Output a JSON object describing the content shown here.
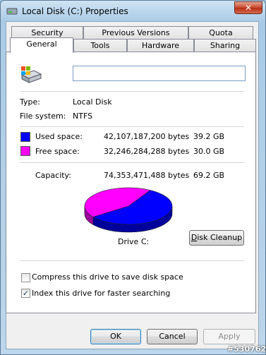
{
  "window": {
    "title": "Local Disk (C:) Properties",
    "close_glyph": "✕"
  },
  "tabs_row1": [
    "Security",
    "Previous Versions",
    "Quota"
  ],
  "tabs_row2": [
    "General",
    "Tools",
    "Hardware",
    "Sharing"
  ],
  "general": {
    "drive_icon": "hard-drive-icon",
    "volume_label_value": "",
    "type_label": "Type:",
    "type_value": "Local Disk",
    "fs_label": "File system:",
    "fs_value": "NTFS",
    "used": {
      "label": "Used space:",
      "bytes": "42,107,187,200 bytes",
      "size": "39.2 GB",
      "color": "#0000ff"
    },
    "free": {
      "label": "Free space:",
      "bytes": "32,246,284,288 bytes",
      "size": "30.0 GB",
      "color": "#ff00ff"
    },
    "capacity": {
      "label": "Capacity:",
      "bytes": "74,353,471,488 bytes",
      "size": "69.2 GB"
    },
    "pie": {
      "used_fraction": 0.566,
      "free_fraction": 0.434
    },
    "drive_caption": "Drive C:",
    "cleanup_label_first": "D",
    "cleanup_label_rest": "isk Cleanup",
    "compress_label": "Compress this drive to save disk space",
    "compress_checked": false,
    "index_label": "Index this drive for faster searching",
    "index_checked": true
  },
  "buttons": {
    "ok": "OK",
    "cancel": "Cancel",
    "apply": "Apply"
  },
  "watermark": "#530762"
}
